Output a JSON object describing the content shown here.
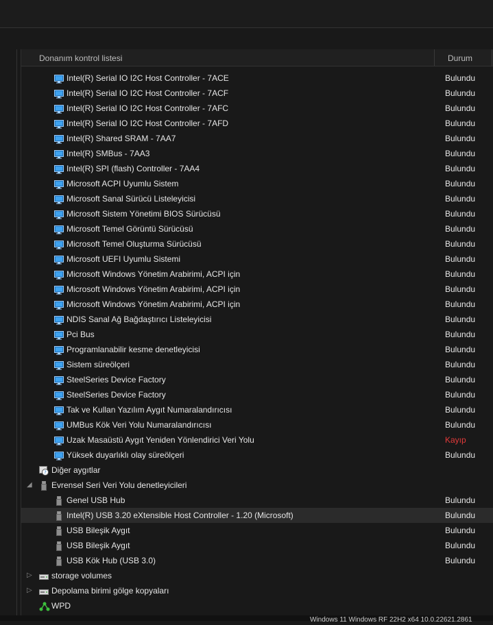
{
  "header": {
    "col_name": "Donanım kontrol listesi",
    "col_status": "Durum"
  },
  "rows": [
    {
      "label": "Intel(R) Serial IO I2C Host Controller - 7ACE",
      "status": "Bulundu",
      "icon": "monitor-device-icon",
      "level": 2
    },
    {
      "label": "Intel(R) Serial IO I2C Host Controller - 7ACF",
      "status": "Bulundu",
      "icon": "monitor-device-icon",
      "level": 2
    },
    {
      "label": "Intel(R) Serial IO I2C Host Controller - 7AFC",
      "status": "Bulundu",
      "icon": "monitor-device-icon",
      "level": 2
    },
    {
      "label": "Intel(R) Serial IO I2C Host Controller - 7AFD",
      "status": "Bulundu",
      "icon": "monitor-device-icon",
      "level": 2
    },
    {
      "label": "Intel(R) Shared SRAM - 7AA7",
      "status": "Bulundu",
      "icon": "monitor-device-icon",
      "level": 2
    },
    {
      "label": "Intel(R) SMBus - 7AA3",
      "status": "Bulundu",
      "icon": "monitor-device-icon",
      "level": 2
    },
    {
      "label": "Intel(R) SPI (flash) Controller - 7AA4",
      "status": "Bulundu",
      "icon": "monitor-device-icon",
      "level": 2
    },
    {
      "label": "Microsoft ACPI Uyumlu Sistem",
      "status": "Bulundu",
      "icon": "monitor-device-icon",
      "level": 2
    },
    {
      "label": "Microsoft Sanal Sürücü Listeleyicisi",
      "status": "Bulundu",
      "icon": "monitor-device-icon",
      "level": 2
    },
    {
      "label": "Microsoft Sistem Yönetimi BIOS Sürücüsü",
      "status": "Bulundu",
      "icon": "monitor-device-icon",
      "level": 2
    },
    {
      "label": "Microsoft Temel Görüntü Sürücüsü",
      "status": "Bulundu",
      "icon": "monitor-device-icon",
      "level": 2
    },
    {
      "label": "Microsoft Temel Oluşturma Sürücüsü",
      "status": "Bulundu",
      "icon": "monitor-device-icon",
      "level": 2
    },
    {
      "label": "Microsoft UEFI Uyumlu Sistemi",
      "status": "Bulundu",
      "icon": "monitor-device-icon",
      "level": 2
    },
    {
      "label": "Microsoft Windows Yönetim Arabirimi, ACPI için",
      "status": "Bulundu",
      "icon": "monitor-device-icon",
      "level": 2
    },
    {
      "label": "Microsoft Windows Yönetim Arabirimi, ACPI için",
      "status": "Bulundu",
      "icon": "monitor-device-icon",
      "level": 2
    },
    {
      "label": "Microsoft Windows Yönetim Arabirimi, ACPI için",
      "status": "Bulundu",
      "icon": "monitor-device-icon",
      "level": 2
    },
    {
      "label": "NDIS Sanal Ağ Bağdaştırıcı Listeleyicisi",
      "status": "Bulundu",
      "icon": "monitor-device-icon",
      "level": 2
    },
    {
      "label": "Pci Bus",
      "status": "Bulundu",
      "icon": "monitor-device-icon",
      "level": 2
    },
    {
      "label": "Programlanabilir kesme denetleyicisi",
      "status": "Bulundu",
      "icon": "monitor-device-icon",
      "level": 2
    },
    {
      "label": "Sistem süreölçeri",
      "status": "Bulundu",
      "icon": "monitor-device-icon",
      "level": 2
    },
    {
      "label": "SteelSeries Device Factory",
      "status": "Bulundu",
      "icon": "monitor-device-icon",
      "level": 2
    },
    {
      "label": "SteelSeries Device Factory",
      "status": "Bulundu",
      "icon": "monitor-device-icon",
      "level": 2
    },
    {
      "label": "Tak ve Kullan Yazılım Aygıt Numaralandırıcısı",
      "status": "Bulundu",
      "icon": "monitor-device-icon",
      "level": 2
    },
    {
      "label": "UMBus Kök Veri Yolu Numaralandırıcısı",
      "status": "Bulundu",
      "icon": "monitor-device-icon",
      "level": 2
    },
    {
      "label": "Uzak Masaüstü Aygıt Yeniden Yönlendirici Veri Yolu",
      "status": "Kayıp",
      "icon": "monitor-device-icon",
      "level": 2,
      "missing": true
    },
    {
      "label": "Yüksek duyarlıklı olay süreölçeri",
      "status": "Bulundu",
      "icon": "monitor-device-icon",
      "level": 2
    },
    {
      "label": "Diğer aygıtlar",
      "status": "",
      "icon": "unknown-device-icon",
      "level": 1
    },
    {
      "label": "Evrensel Seri Veri Yolu denetleyicileri",
      "status": "",
      "icon": "usb-plug-icon",
      "level": 1,
      "expanded": true
    },
    {
      "label": "Genel USB Hub",
      "status": "Bulundu",
      "icon": "usb-plug-icon",
      "level": 2
    },
    {
      "label": "Intel(R) USB 3.20 eXtensible Host Controller - 1.20 (Microsoft)",
      "status": "Bulundu",
      "icon": "usb-plug-icon",
      "level": 2,
      "selected": true
    },
    {
      "label": "USB Bileşik Aygıt",
      "status": "Bulundu",
      "icon": "usb-plug-icon",
      "level": 2
    },
    {
      "label": "USB Bileşik Aygıt",
      "status": "Bulundu",
      "icon": "usb-plug-icon",
      "level": 2
    },
    {
      "label": "USB Kök Hub (USB 3.0)",
      "status": "Bulundu",
      "icon": "usb-plug-icon",
      "level": 2
    },
    {
      "label": "storage volumes",
      "status": "",
      "icon": "drive-icon",
      "level": 1,
      "collapsed": true
    },
    {
      "label": "Depolama birimi gölge kopyaları",
      "status": "",
      "icon": "drive-icon",
      "level": 1,
      "collapsed": true
    },
    {
      "label": "WPD",
      "status": "",
      "icon": "wpd-icon",
      "level": 1
    }
  ],
  "statusbar": {
    "text": "Windows 11 Windows RF 22H2 x64 10.0.22621.2861"
  },
  "colors": {
    "missing": "#e43a3a",
    "found": "#e6e6e6"
  }
}
